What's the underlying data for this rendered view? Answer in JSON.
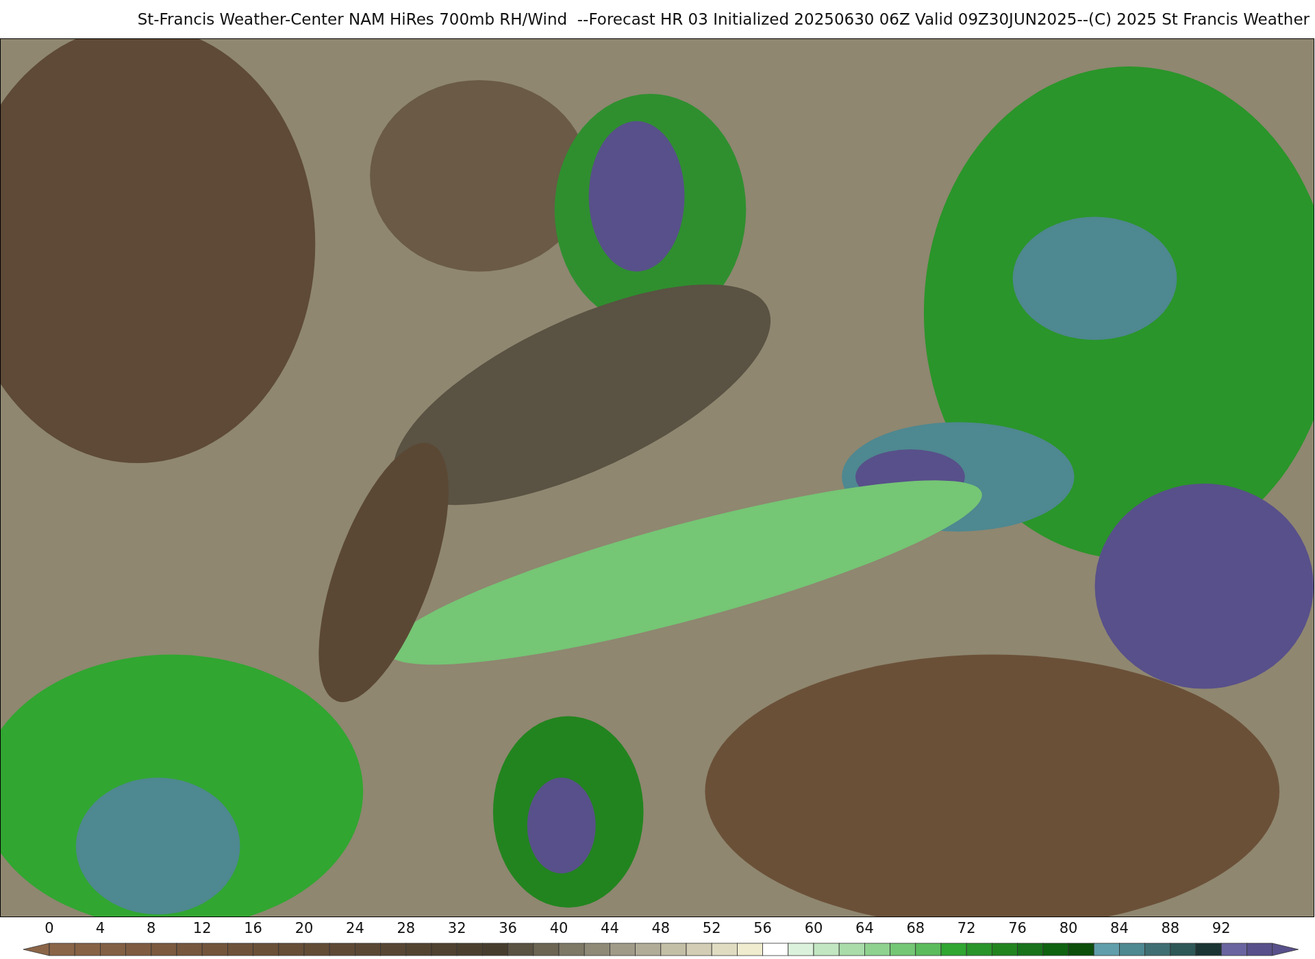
{
  "title": "St-Francis Weather-Center NAM HiRes 700mb RH/Wind  --Forecast HR 03 Initialized 20250630 06Z Valid 09Z30JUN2025--(C) 2025 St Francis Weather",
  "colorbar": {
    "ticks": [
      "0",
      "4",
      "8",
      "12",
      "16",
      "20",
      "24",
      "28",
      "32",
      "36",
      "40",
      "44",
      "48",
      "52",
      "56",
      "60",
      "64",
      "68",
      "72",
      "76",
      "80",
      "84",
      "88",
      "92"
    ],
    "segments": [
      {
        "color": "#8b6548"
      },
      {
        "color": "#876245"
      },
      {
        "color": "#835f43"
      },
      {
        "color": "#7f5c41"
      },
      {
        "color": "#7b5a3f"
      },
      {
        "color": "#77573d"
      },
      {
        "color": "#73553c"
      },
      {
        "color": "#6f523a"
      },
      {
        "color": "#6b5038"
      },
      {
        "color": "#674e37"
      },
      {
        "color": "#634c36"
      },
      {
        "color": "#5f4a35"
      },
      {
        "color": "#5b4834"
      },
      {
        "color": "#574633"
      },
      {
        "color": "#534432"
      },
      {
        "color": "#4f4231"
      },
      {
        "color": "#4b402f"
      },
      {
        "color": "#473d2e"
      },
      {
        "color": "#5a5242"
      },
      {
        "color": "#6c6554"
      },
      {
        "color": "#7e7866"
      },
      {
        "color": "#8f8a78"
      },
      {
        "color": "#a09b88"
      },
      {
        "color": "#b1ac98"
      },
      {
        "color": "#c3bfa6"
      },
      {
        "color": "#d2cdb4"
      },
      {
        "color": "#e0dcc2"
      },
      {
        "color": "#efeccf"
      },
      {
        "color": "#ffffff"
      },
      {
        "color": "#dcf1dc"
      },
      {
        "color": "#c2e6c2"
      },
      {
        "color": "#a9dca9"
      },
      {
        "color": "#8fd18f"
      },
      {
        "color": "#75c675"
      },
      {
        "color": "#5cbb5c"
      },
      {
        "color": "#31a631"
      },
      {
        "color": "#2a952a"
      },
      {
        "color": "#22841f"
      },
      {
        "color": "#18731a"
      },
      {
        "color": "#0f6210"
      },
      {
        "color": "#0b4f0b"
      },
      {
        "color": "#5f9eaa"
      },
      {
        "color": "#4e8890"
      },
      {
        "color": "#3f6f72"
      },
      {
        "color": "#2e5858"
      },
      {
        "color": "#1b3534"
      },
      {
        "color": "#6a64a0"
      },
      {
        "color": "#58508a"
      }
    ]
  }
}
